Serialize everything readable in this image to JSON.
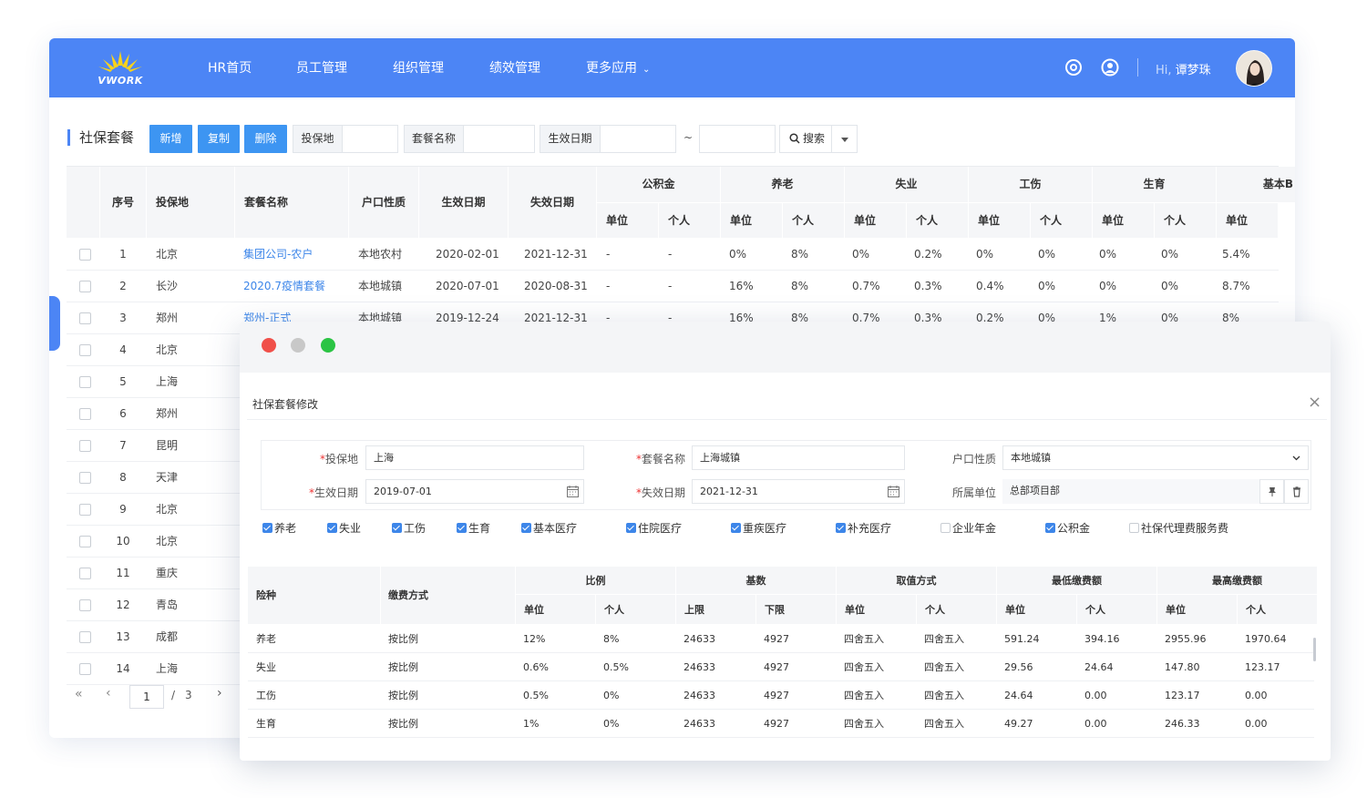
{
  "app": {
    "logo_text": "VWORK",
    "nav": [
      "HR首页",
      "员工管理",
      "组织管理",
      "绩效管理",
      "更多应用"
    ],
    "greeting_prefix": "Hi,",
    "user_name": "谭梦珠",
    "accent": "#4c85f5"
  },
  "toolbar": {
    "title": "社保套餐",
    "add": "新增",
    "copy": "复制",
    "delete": "删除",
    "location_label": "投保地",
    "package_label": "套餐名称",
    "date_label": "生效日期",
    "tilde": "~",
    "search": "搜索"
  },
  "grid": {
    "headers": {
      "seq": "序号",
      "location": "投保地",
      "package": "套餐名称",
      "hukou": "户口性质",
      "start": "生效日期",
      "end": "失效日期",
      "groups": [
        "公积金",
        "养老",
        "失业",
        "工伤",
        "生育",
        "基本B"
      ],
      "unit": "单位",
      "personal": "个人"
    },
    "rows": [
      {
        "seq": "1",
        "loc": "北京",
        "pkg": "集团公司-农户",
        "hukou": "本地农村",
        "start": "2020-02-01",
        "end": "2021-12-31",
        "v": [
          "-",
          "-",
          "0%",
          "8%",
          "0%",
          "0.2%",
          "0%",
          "0%",
          "0%",
          "0%",
          "5.4%"
        ]
      },
      {
        "seq": "2",
        "loc": "长沙",
        "pkg": "2020.7疫情套餐",
        "hukou": "本地城镇",
        "start": "2020-07-01",
        "end": "2020-08-31",
        "v": [
          "-",
          "-",
          "16%",
          "8%",
          "0.7%",
          "0.3%",
          "0.4%",
          "0%",
          "0%",
          "0%",
          "8.7%"
        ]
      },
      {
        "seq": "3",
        "loc": "郑州",
        "pkg": "郑州-正式",
        "hukou": "本地城镇",
        "start": "2019-12-24",
        "end": "2021-12-31",
        "v": [
          "-",
          "-",
          "16%",
          "8%",
          "0.7%",
          "0.3%",
          "0.2%",
          "0%",
          "1%",
          "0%",
          "8%"
        ]
      },
      {
        "seq": "4",
        "loc": "北京"
      },
      {
        "seq": "5",
        "loc": "上海"
      },
      {
        "seq": "6",
        "loc": "郑州"
      },
      {
        "seq": "7",
        "loc": "昆明"
      },
      {
        "seq": "8",
        "loc": "天津"
      },
      {
        "seq": "9",
        "loc": "北京"
      },
      {
        "seq": "10",
        "loc": "北京"
      },
      {
        "seq": "11",
        "loc": "重庆"
      },
      {
        "seq": "12",
        "loc": "青岛"
      },
      {
        "seq": "13",
        "loc": "成都"
      },
      {
        "seq": "14",
        "loc": "上海"
      }
    ]
  },
  "pager": {
    "current": "1",
    "sep": "/",
    "total": "3",
    "first": "«",
    "prev": "‹",
    "next": "›"
  },
  "modal": {
    "title": "社保套餐修改",
    "close": "×",
    "form": {
      "location_label": "投保地",
      "location_value": "上海",
      "package_label": "套餐名称",
      "package_value": "上海城镇",
      "hukou_label": "户口性质",
      "hukou_value": "本地城镇",
      "start_label": "生效日期",
      "start_value": "2019-07-01",
      "end_label": "失效日期",
      "end_value": "2021-12-31",
      "dept_label": "所属单位",
      "dept_value": "总部项目部",
      "required_mark": "*"
    },
    "checkboxes": [
      {
        "label": "养老",
        "checked": true
      },
      {
        "label": "失业",
        "checked": true
      },
      {
        "label": "工伤",
        "checked": true
      },
      {
        "label": "生育",
        "checked": true
      },
      {
        "label": "基本医疗",
        "checked": true
      },
      {
        "label": "住院医疗",
        "checked": true
      },
      {
        "label": "重疾医疗",
        "checked": true
      },
      {
        "label": "补充医疗",
        "checked": true
      },
      {
        "label": "企业年金",
        "checked": false
      },
      {
        "label": "公积金",
        "checked": true
      },
      {
        "label": "社保代理费服务费",
        "checked": false
      }
    ],
    "table": {
      "h_type": "险种",
      "h_method": "缴费方式",
      "h_ratio": "比例",
      "h_base": "基数",
      "h_round": "取值方式",
      "h_min": "最低缴费额",
      "h_max": "最高缴费额",
      "h_unit": "单位",
      "h_personal": "个人",
      "h_upper": "上限",
      "h_lower": "下限",
      "rows": [
        [
          "养老",
          "按比例",
          "12%",
          "8%",
          "24633",
          "4927",
          "四舍五入",
          "四舍五入",
          "591.24",
          "394.16",
          "2955.96",
          "1970.64"
        ],
        [
          "失业",
          "按比例",
          "0.6%",
          "0.5%",
          "24633",
          "4927",
          "四舍五入",
          "四舍五入",
          "29.56",
          "24.64",
          "147.80",
          "123.17"
        ],
        [
          "工伤",
          "按比例",
          "0.5%",
          "0%",
          "24633",
          "4927",
          "四舍五入",
          "四舍五入",
          "24.64",
          "0.00",
          "123.17",
          "0.00"
        ],
        [
          "生育",
          "按比例",
          "1%",
          "0%",
          "24633",
          "4927",
          "四舍五入",
          "四舍五入",
          "49.27",
          "0.00",
          "246.33",
          "0.00"
        ]
      ]
    }
  }
}
